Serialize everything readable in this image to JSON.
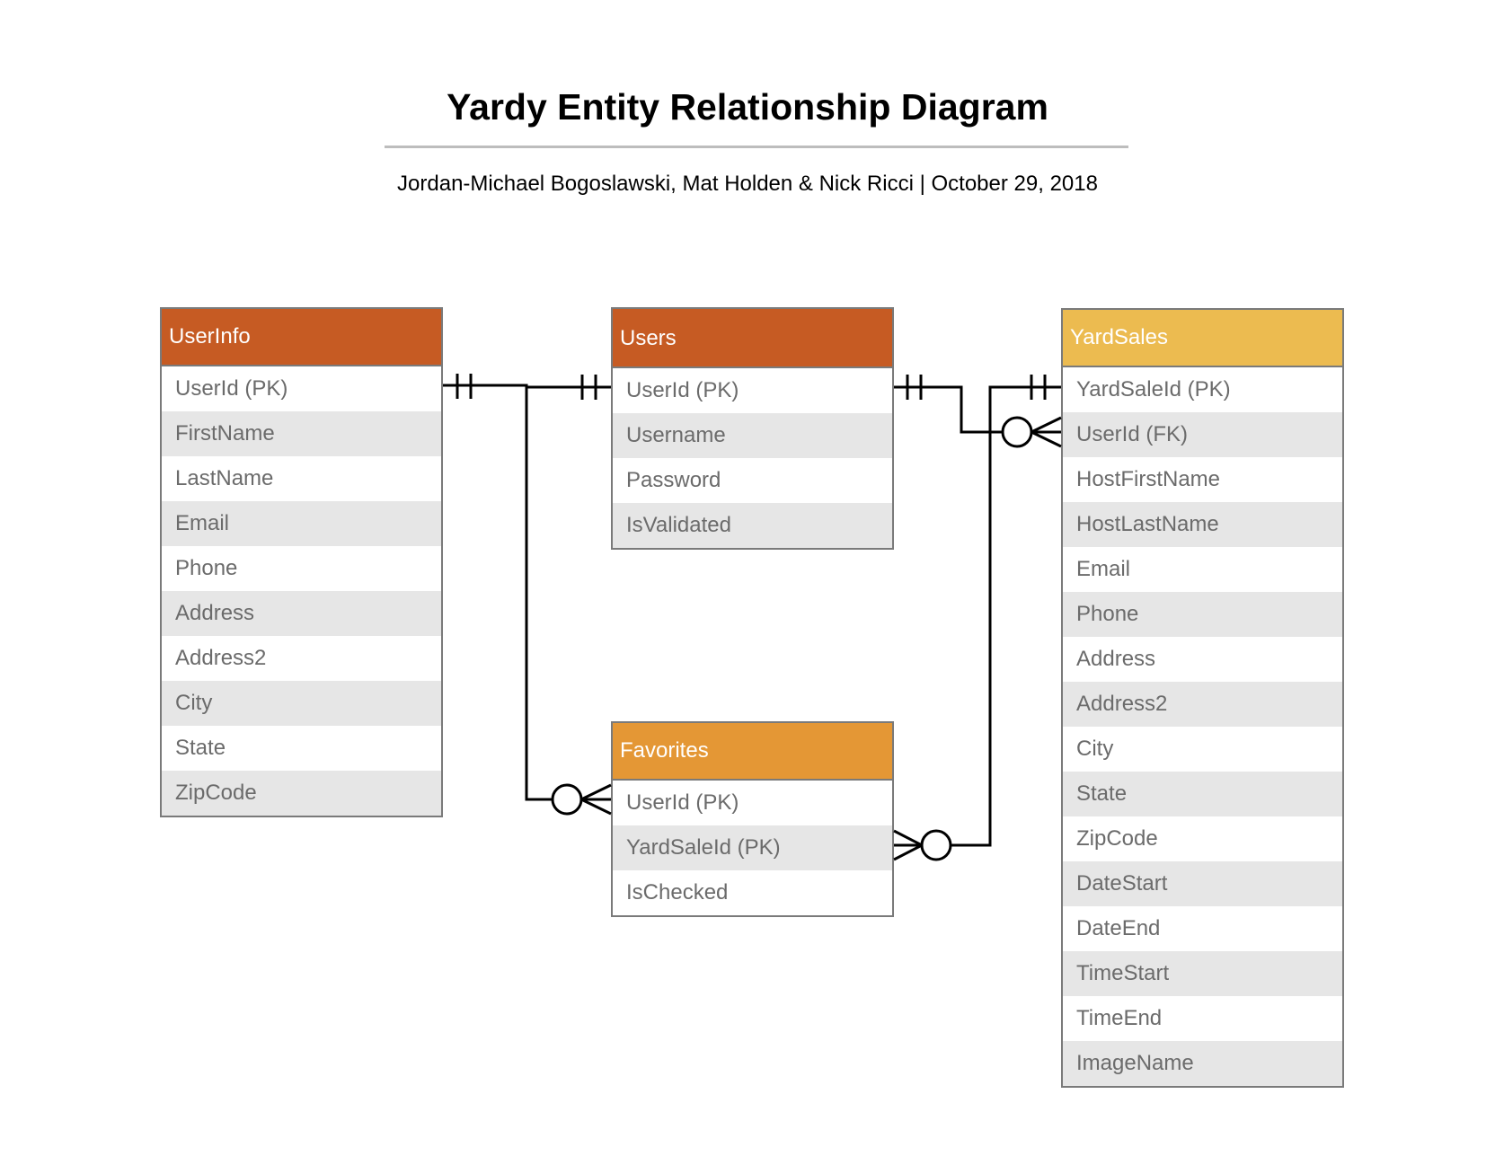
{
  "title": "Yardy Entity Relationship Diagram",
  "subtitle": "Jordan-Michael Bogoslawski, Mat Holden & Nick Ricci  |  October 29, 2018",
  "colors": {
    "dark_orange": "#c65b23",
    "orange": "#e49735",
    "gold": "#ecbb50",
    "row_alt": "#e6e6e6"
  },
  "entities": {
    "userinfo": {
      "name": "UserInfo",
      "fields": [
        "UserId (PK)",
        "FirstName",
        "LastName",
        "Email",
        "Phone",
        "Address",
        "Address2",
        "City",
        "State",
        "ZipCode"
      ]
    },
    "users": {
      "name": "Users",
      "fields": [
        "UserId (PK)",
        "Username",
        "Password",
        "IsValidated"
      ]
    },
    "favorites": {
      "name": "Favorites",
      "fields": [
        "UserId (PK)",
        "YardSaleId (PK)",
        "IsChecked"
      ]
    },
    "yardsales": {
      "name": "YardSales",
      "fields": [
        "YardSaleId (PK)",
        "UserId (FK)",
        "HostFirstName",
        "HostLastName",
        "Email",
        "Phone",
        "Address",
        "Address2",
        "City",
        "State",
        "ZipCode",
        "DateStart",
        "DateEnd",
        "TimeStart",
        "TimeEnd",
        "ImageName"
      ]
    }
  },
  "relationships": [
    {
      "from": "UserInfo.UserId",
      "to": "Users.UserId",
      "type": "one-to-one"
    },
    {
      "from": "UserInfo.UserId",
      "to": "Favorites.UserId",
      "type": "one-to-zero-or-many"
    },
    {
      "from": "Users.UserId",
      "to": "YardSales.UserId",
      "type": "one-to-zero-or-many"
    },
    {
      "from": "YardSales.YardSaleId",
      "to": "Favorites.YardSaleId",
      "type": "one-to-zero-or-many"
    }
  ]
}
